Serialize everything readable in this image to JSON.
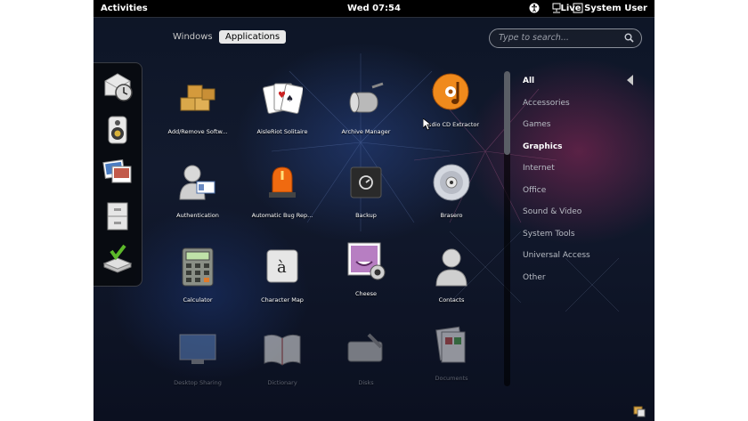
{
  "topbar": {
    "activities": "Activities",
    "clock": "Wed 07:54",
    "user": "Live System User"
  },
  "tabs": {
    "windows": "Windows",
    "applications": "Applications"
  },
  "search": {
    "placeholder": "Type to search..."
  },
  "dash": {
    "items": [
      "mail-clock-icon",
      "speaker-icon",
      "photos-icon",
      "file-cabinet-icon",
      "install-icon"
    ]
  },
  "apps": [
    {
      "label": "Add/Remove Softw...",
      "icon": "boxes-icon"
    },
    {
      "label": "AisleRiot Solitaire",
      "icon": "playing-cards-icon"
    },
    {
      "label": "Archive Manager",
      "icon": "archive-roller-icon"
    },
    {
      "label": "Audio CD Extractor",
      "icon": "orange-cd-icon"
    },
    {
      "label": "Authentication",
      "icon": "user-badge-icon"
    },
    {
      "label": "Automatic Bug Rep...",
      "icon": "alarm-light-icon"
    },
    {
      "label": "Backup",
      "icon": "safe-icon"
    },
    {
      "label": "Brasero",
      "icon": "disc-icon"
    },
    {
      "label": "Calculator",
      "icon": "calculator-icon"
    },
    {
      "label": "Character Map",
      "icon": "character-key-icon"
    },
    {
      "label": "Cheese",
      "icon": "webcam-photo-icon"
    },
    {
      "label": "Contacts",
      "icon": "contact-person-icon"
    },
    {
      "label": "Desktop Sharing",
      "icon": "monitor-icon"
    },
    {
      "label": "Dictionary",
      "icon": "book-icon"
    },
    {
      "label": "Disks",
      "icon": "disk-tool-icon"
    },
    {
      "label": "Documents",
      "icon": "documents-icon"
    }
  ],
  "categories": [
    {
      "label": "All",
      "active": true
    },
    {
      "label": "Accessories",
      "active": false
    },
    {
      "label": "Games",
      "active": false
    },
    {
      "label": "Graphics",
      "active": true
    },
    {
      "label": "Internet",
      "active": false
    },
    {
      "label": "Office",
      "active": false
    },
    {
      "label": "Sound & Video",
      "active": false
    },
    {
      "label": "System Tools",
      "active": false
    },
    {
      "label": "Universal Access",
      "active": false
    },
    {
      "label": "Other",
      "active": false
    }
  ],
  "colors": {
    "topbar": "#000000",
    "tab_active_bg": "#e8e8e8",
    "background": "#121a2e"
  }
}
